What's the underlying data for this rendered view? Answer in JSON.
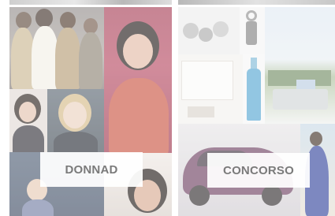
{
  "tiles": {
    "left": {
      "label": "DONNAD"
    },
    "right": {
      "label": "CONCORSO"
    }
  },
  "colors": {
    "label_text": "#7a7a7a",
    "label_bg": "#ffffff"
  }
}
